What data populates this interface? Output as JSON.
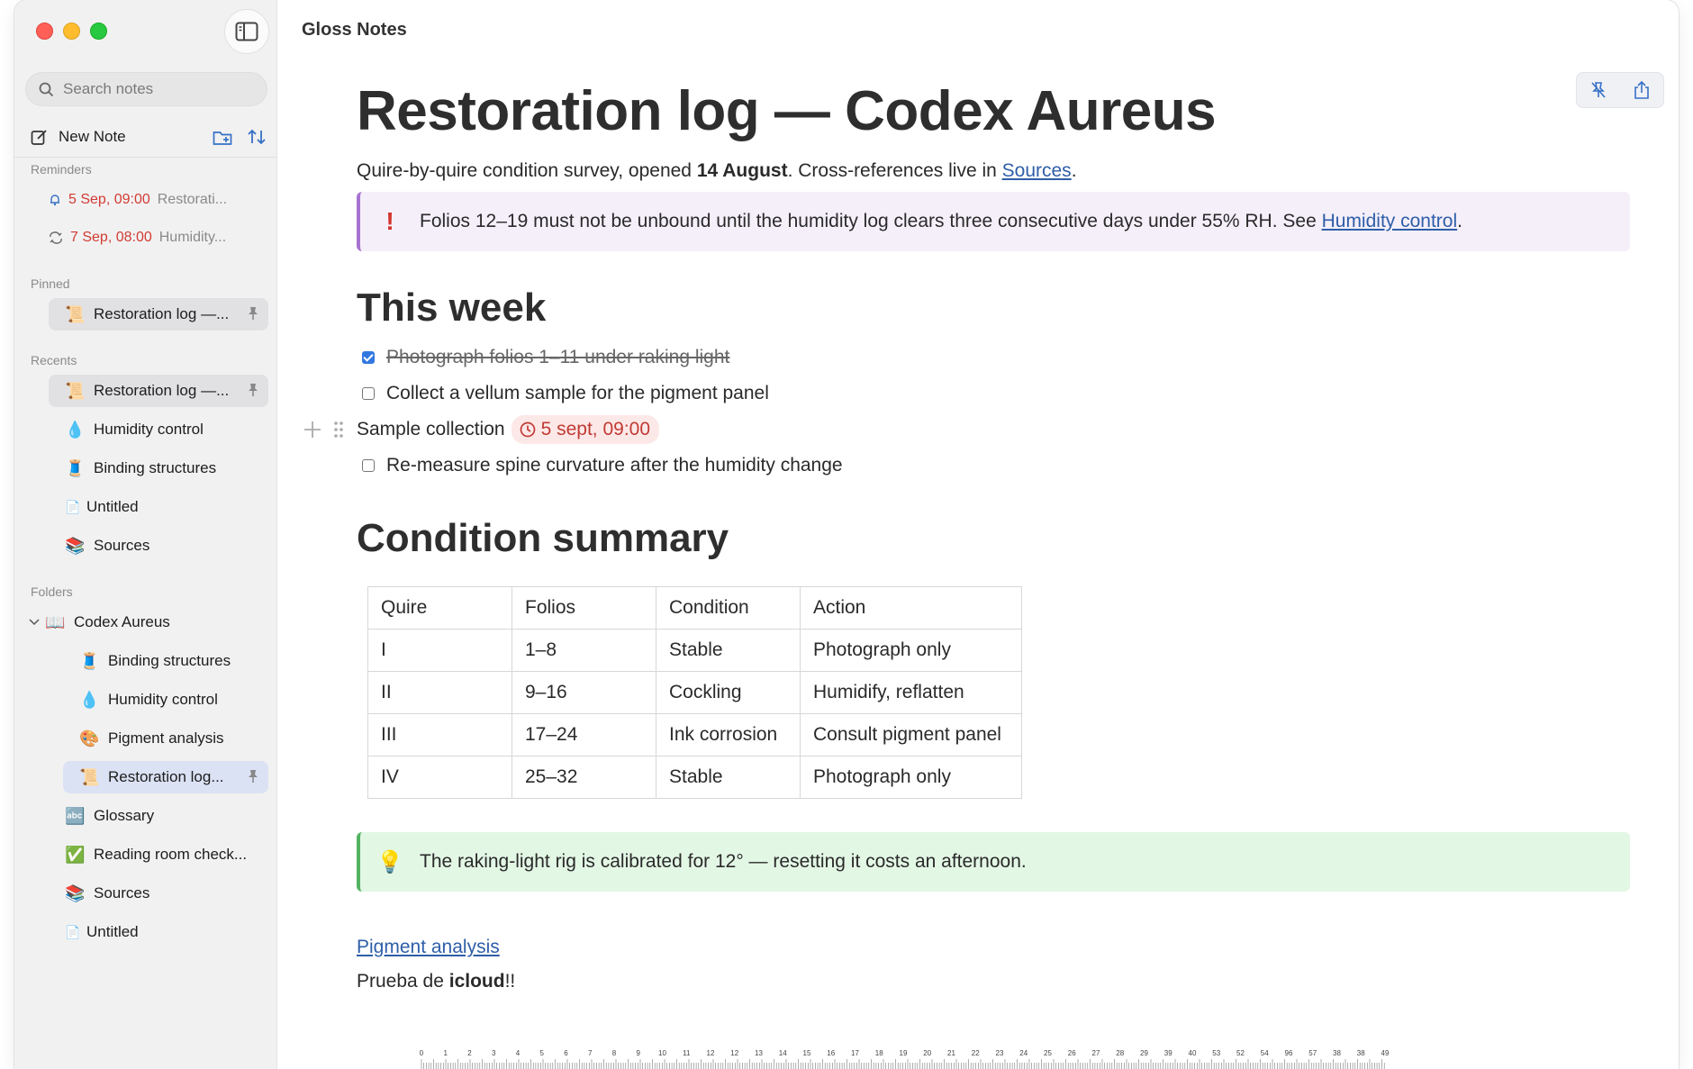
{
  "app": {
    "title": "Gloss Notes"
  },
  "sidebar": {
    "search_placeholder": "Search notes",
    "new_note_label": "New Note",
    "sections": {
      "reminders": "Reminders",
      "pinned": "Pinned",
      "recents": "Recents",
      "folders": "Folders"
    },
    "reminders": [
      {
        "time": "5 Sep, 09:00",
        "text": "Restorati...",
        "icon": "bell-icon"
      },
      {
        "time": "7 Sep, 08:00",
        "text": "Humidity...",
        "icon": "repeat-icon"
      }
    ],
    "pinned": [
      {
        "emoji": "📜",
        "label": "Restoration log —..."
      }
    ],
    "recents": [
      {
        "emoji": "📜",
        "label": "Restoration log —..."
      },
      {
        "emoji": "💧",
        "label": "Humidity control"
      },
      {
        "emoji": "🧵",
        "label": "Binding structures"
      },
      {
        "emoji": "📄",
        "label": "Untitled"
      },
      {
        "emoji": "📚",
        "label": "Sources"
      }
    ],
    "folder": {
      "emoji": "📖",
      "label": "Codex Aureus"
    },
    "folder_children": [
      {
        "emoji": "🧵",
        "label": "Binding structures"
      },
      {
        "emoji": "💧",
        "label": "Humidity control"
      },
      {
        "emoji": "🎨",
        "label": "Pigment analysis"
      },
      {
        "emoji": "📜",
        "label": "Restoration log..."
      }
    ],
    "root_items": [
      {
        "emoji": "🔤",
        "label": "Glossary"
      },
      {
        "emoji": "✅",
        "label": "Reading room check..."
      },
      {
        "emoji": "📚",
        "label": "Sources"
      },
      {
        "emoji": "📄",
        "label": "Untitled"
      }
    ]
  },
  "note": {
    "title": "Restoration log — Codex Aureus",
    "subtitle": {
      "pre": "Quire-by-quire condition survey, opened ",
      "bold": "14 August",
      "mid": ". Cross-references live in ",
      "link": "Sources",
      "post": "."
    },
    "warning": {
      "icon": "!",
      "text": "Folios 12–19 must not be unbound until the humidity log clears three consecutive days under 55% RH. See ",
      "link": "Humidity control",
      "post": "."
    },
    "heading_week": "This week",
    "tasks": [
      {
        "text": "Photograph folios 1–11 under raking light",
        "done": true
      },
      {
        "text": "Collect a vellum sample for the pigment panel",
        "done": false
      }
    ],
    "sample_line": {
      "text": "Sample collection",
      "reminder": "5 sept, 09:00"
    },
    "task_after": {
      "text": "Re-measure spine curvature after the humidity change",
      "done": false
    },
    "heading_condition": "Condition summary",
    "table": {
      "headers": [
        "Quire",
        "Folios",
        "Condition",
        "Action"
      ],
      "rows": [
        [
          "I",
          "1–8",
          "Stable",
          "Photograph only"
        ],
        [
          "II",
          "9–16",
          "Cockling",
          "Humidify, reflatten"
        ],
        [
          "III",
          "17–24",
          "Ink corrosion",
          "Consult pigment panel"
        ],
        [
          "IV",
          "25–32",
          "Stable",
          "Photograph only"
        ]
      ]
    },
    "tip": {
      "icon": "💡",
      "text": "The raking-light rig is calibrated for 12° — resetting it costs an afternoon."
    },
    "link_pigment": "Pigment analysis",
    "footer": {
      "pre": "Prueba de ",
      "bold": "icloud",
      "post": "!!"
    },
    "ruler_labels": [
      "0",
      "1",
      "2",
      "3",
      "4",
      "5",
      "6",
      "7",
      "8",
      "9",
      "10",
      "11",
      "12",
      "12",
      "13",
      "14",
      "15",
      "16",
      "17",
      "18",
      "19",
      "20",
      "21",
      "22",
      "23",
      "24",
      "25",
      "26",
      "27",
      "28",
      "29",
      "39",
      "40",
      "53",
      "52",
      "54",
      "96",
      "57",
      "38",
      "38",
      "49"
    ]
  },
  "colors": {
    "accent": "#2e5ea8",
    "reminder_red": "#d23b34",
    "warning_border": "#a673cf",
    "tip_border": "#53b360"
  }
}
